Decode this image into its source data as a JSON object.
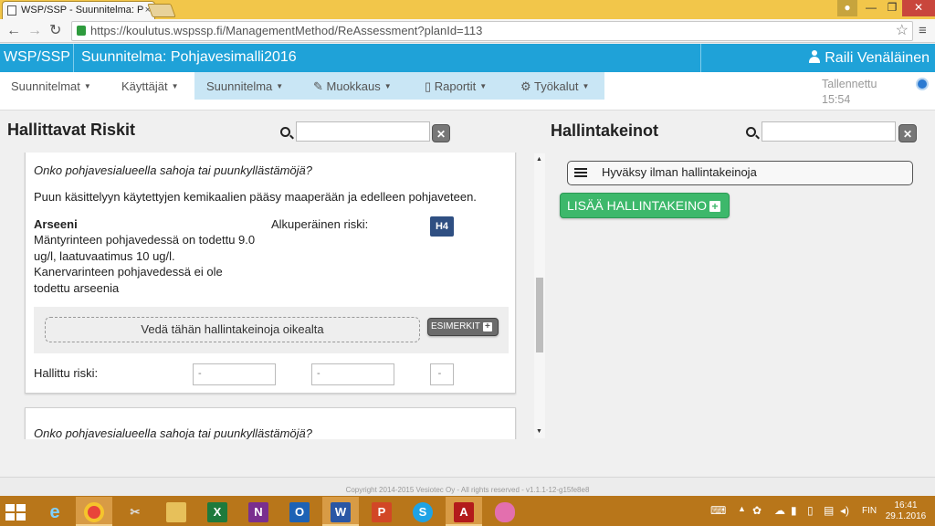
{
  "browser": {
    "tab_title": "WSP/SSP - Suunnitelma: P",
    "url": "https://koulutus.wspssp.fi/ManagementMethod/ReAssessment?planId=113"
  },
  "header": {
    "brand": "WSP/SSP",
    "plan_title": "Suunnitelma: Pohjavesimalli2016",
    "user": "Raili Venäläinen"
  },
  "menu": {
    "items": [
      "Suunnitelmat",
      "Käyttäjät",
      "Suunnitelma",
      "Muokkaus",
      "Raportit",
      "Työkalut"
    ],
    "saved_line1": "Tallennettu",
    "saved_line2": "15:54"
  },
  "risks_panel": {
    "title": "Hallittavat Riskit",
    "search_placeholder": "",
    "card1": {
      "question": "Onko pohjavesialueella sahoja tai puunkyllästämöjä?",
      "description": "Puun käsittelyyn käytettyjen kemikaalien pääsy maaperään ja edelleen pohjaveteen.",
      "hazard": "Arseeni",
      "hazard_lines": [
        "Mäntyrinteen pohjavedessä on  todettu 9.0",
        "ug/l, laatuvaatimus     10 ug/l.",
        "Kanervarinteen pohjavedessä ei ole",
        " todettu arseenia"
      ],
      "original_risk_label": "Alkuperäinen riski:",
      "original_risk": "H4",
      "drop_zone": "Vedä tähän hallintakeinoja oikealta",
      "examples_button": "ESIMERKIT",
      "managed_risk_label": "Hallittu riski:",
      "managed_values": [
        "-",
        "-",
        "-"
      ]
    },
    "card2": {
      "question": "Onko pohjavesialueella sahoja tai puunkyllästämöjä?"
    }
  },
  "measures_panel": {
    "title": "Hallintakeinot",
    "search_placeholder": "",
    "items": [
      "Hyväksy ilman hallintakeinoja"
    ],
    "add_button": "LISÄÄ HALLINTAKEINO"
  },
  "footer": {
    "copyright": "Copyright 2014-2015 Vesiotec Oy - All rights reserved - v1.1.1-12-g15fe8e8"
  },
  "taskbar": {
    "language": "FIN",
    "time": "16:41",
    "date": "29.1.2016"
  }
}
